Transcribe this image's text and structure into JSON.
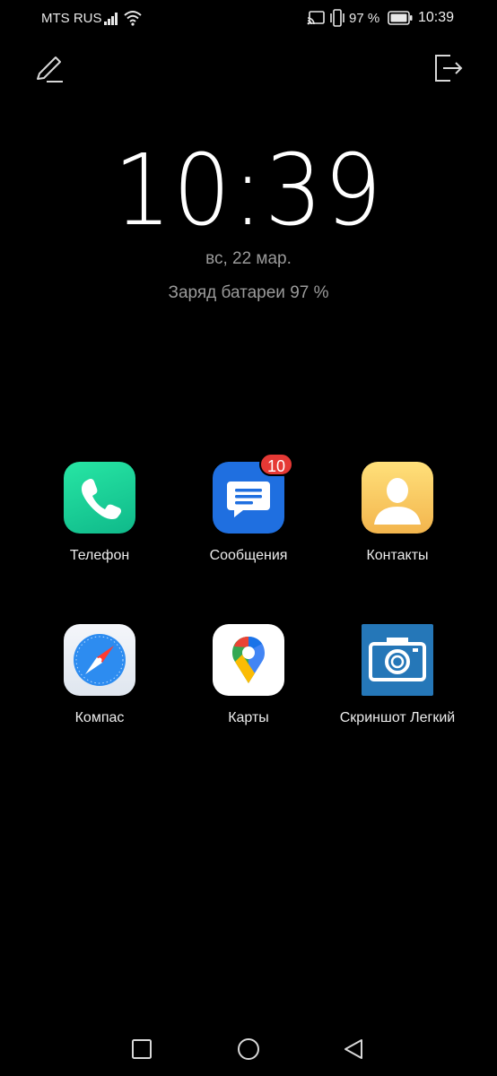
{
  "status_bar": {
    "carrier": "MTS RUS",
    "battery_percent": "97 %",
    "time": "10:39",
    "icons": [
      "signal-icon",
      "wifi-icon",
      "cast-icon",
      "vibrate-icon",
      "battery-icon"
    ]
  },
  "top_actions": {
    "left_icon": "edit-icon",
    "right_icon": "exit-icon"
  },
  "lockscreen": {
    "clock": "10:39",
    "date": "вс, 22 мар.",
    "battery_status": "Заряд батареи 97 %"
  },
  "apps": [
    {
      "label": "Телефон",
      "icon": "phone-icon",
      "color": "#1fd89a"
    },
    {
      "label": "Сообщения",
      "icon": "messages-icon",
      "color": "#1f6fe0",
      "badge": "10"
    },
    {
      "label": "Контакты",
      "icon": "contacts-icon",
      "color": "#f6c660"
    },
    {
      "label": "Компас",
      "icon": "compass-icon",
      "color": "#2d8cf0"
    },
    {
      "label": "Карты",
      "icon": "maps-icon",
      "color": "#ffffff"
    },
    {
      "label": "Скриншот Легкий",
      "icon": "camera-icon",
      "color": "#2577b8"
    }
  ],
  "nav_bar": {
    "icons": [
      "recents-square-icon",
      "home-circle-icon",
      "back-triangle-icon"
    ]
  }
}
